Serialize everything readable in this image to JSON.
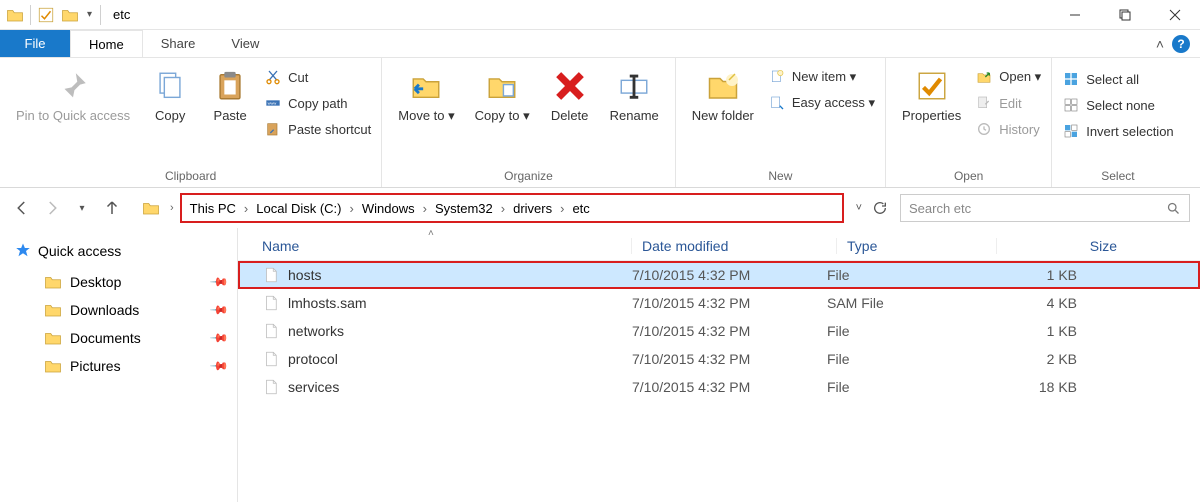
{
  "window": {
    "title": "etc"
  },
  "tabs": {
    "file": "File",
    "home": "Home",
    "share": "Share",
    "view": "View"
  },
  "ribbon": {
    "clipboard": {
      "label": "Clipboard",
      "pin": "Pin to Quick access",
      "copy": "Copy",
      "paste": "Paste",
      "cut": "Cut",
      "copy_path": "Copy path",
      "paste_shortcut": "Paste shortcut"
    },
    "organize": {
      "label": "Organize",
      "move_to": "Move to ▾",
      "copy_to": "Copy to ▾",
      "delete": "Delete",
      "rename": "Rename"
    },
    "new_group": {
      "label": "New",
      "new_folder": "New folder",
      "new_item": "New item ▾",
      "easy_access": "Easy access ▾"
    },
    "open_group": {
      "label": "Open",
      "properties": "Properties",
      "open": "Open ▾",
      "edit": "Edit",
      "history": "History"
    },
    "select_group": {
      "label": "Select",
      "select_all": "Select all",
      "select_none": "Select none",
      "invert": "Invert selection"
    }
  },
  "breadcrumb": [
    "This PC",
    "Local Disk (C:)",
    "Windows",
    "System32",
    "drivers",
    "etc"
  ],
  "search": {
    "placeholder": "Search etc"
  },
  "sidebar": {
    "quick_access": "Quick access",
    "items": [
      {
        "label": "Desktop"
      },
      {
        "label": "Downloads"
      },
      {
        "label": "Documents"
      },
      {
        "label": "Pictures"
      }
    ]
  },
  "columns": {
    "name": "Name",
    "date": "Date modified",
    "type": "Type",
    "size": "Size"
  },
  "files": [
    {
      "name": "hosts",
      "date": "7/10/2015 4:32 PM",
      "type": "File",
      "size": "1 KB",
      "selected": true
    },
    {
      "name": "lmhosts.sam",
      "date": "7/10/2015 4:32 PM",
      "type": "SAM File",
      "size": "4 KB",
      "selected": false
    },
    {
      "name": "networks",
      "date": "7/10/2015 4:32 PM",
      "type": "File",
      "size": "1 KB",
      "selected": false
    },
    {
      "name": "protocol",
      "date": "7/10/2015 4:32 PM",
      "type": "File",
      "size": "2 KB",
      "selected": false
    },
    {
      "name": "services",
      "date": "7/10/2015 4:32 PM",
      "type": "File",
      "size": "18 KB",
      "selected": false
    }
  ]
}
